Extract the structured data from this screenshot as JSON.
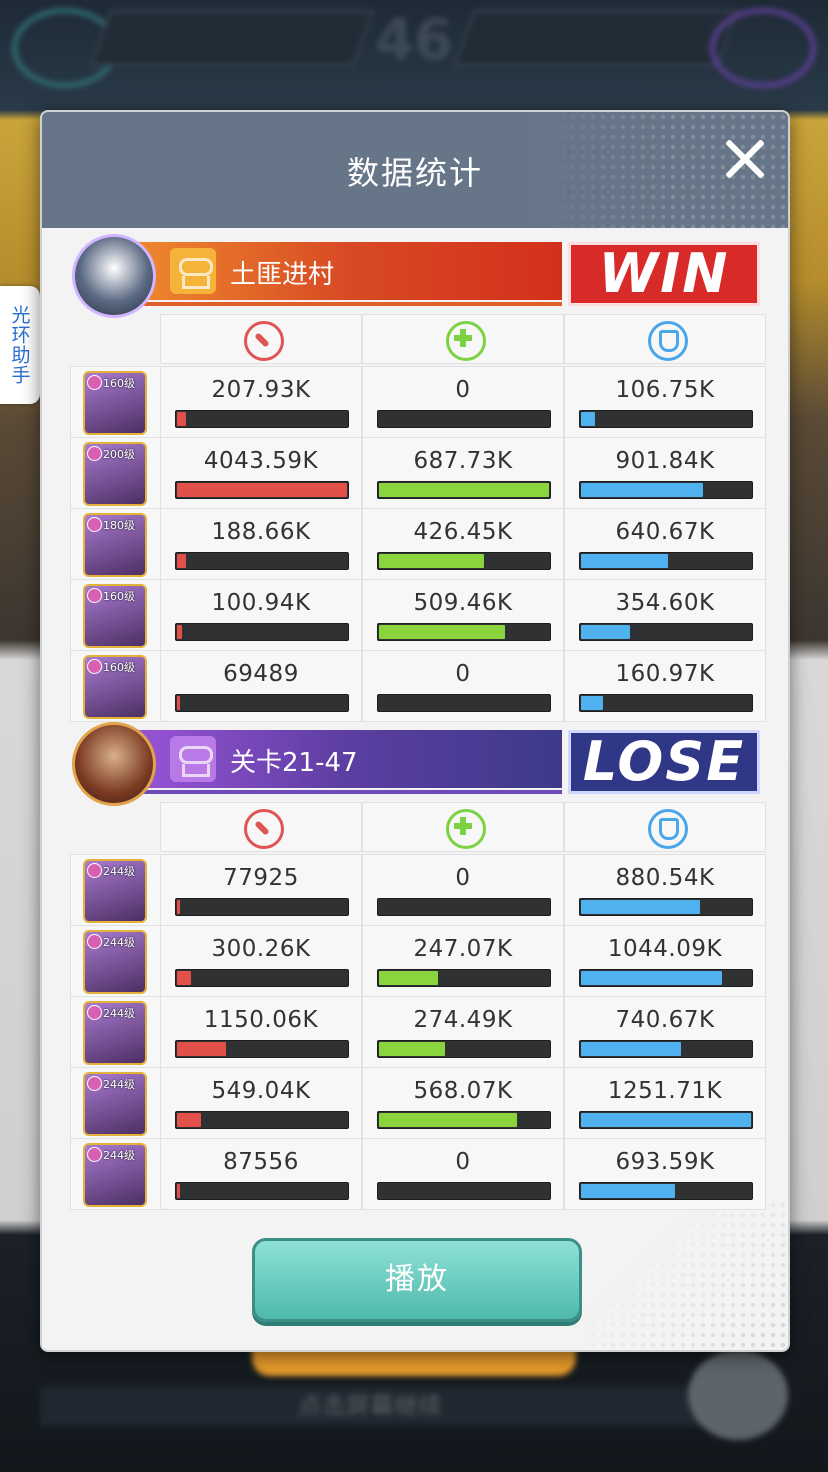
{
  "background": {
    "top_center": "46",
    "bottom_text": "点击屏幕继续"
  },
  "side_tab": {
    "label": "光环助手"
  },
  "modal": {
    "title": "数据统计",
    "play_label": "播放",
    "accent_colors": {
      "damage": "#e2504a",
      "heal": "#8ad43e",
      "defense": "#4fb1ee"
    }
  },
  "teams": [
    {
      "name": "土匪进村",
      "result": "WIN",
      "color": "#d84a23",
      "heroes": [
        {
          "level": "160级",
          "damage": "207.93K",
          "heal": "0",
          "defense": "106.75K",
          "damage_pct": 0.05,
          "heal_pct": 0,
          "defense_pct": 0.08
        },
        {
          "level": "200级",
          "damage": "4043.59K",
          "heal": "687.73K",
          "defense": "901.84K",
          "damage_pct": 1.0,
          "heal_pct": 1.0,
          "defense_pct": 0.72
        },
        {
          "level": "180级",
          "damage": "188.66K",
          "heal": "426.45K",
          "defense": "640.67K",
          "damage_pct": 0.05,
          "heal_pct": 0.62,
          "defense_pct": 0.51
        },
        {
          "level": "160级",
          "damage": "100.94K",
          "heal": "509.46K",
          "defense": "354.60K",
          "damage_pct": 0.03,
          "heal_pct": 0.74,
          "defense_pct": 0.29
        },
        {
          "level": "160级",
          "damage": "69489",
          "heal": "0",
          "defense": "160.97K",
          "damage_pct": 0.02,
          "heal_pct": 0,
          "defense_pct": 0.13
        }
      ]
    },
    {
      "name": "关卡21-47",
      "result": "LOSE",
      "color": "#3d3a8a",
      "heroes": [
        {
          "level": "244级",
          "damage": "77925",
          "heal": "0",
          "defense": "880.54K",
          "damage_pct": 0.02,
          "heal_pct": 0,
          "defense_pct": 0.7
        },
        {
          "level": "244级",
          "damage": "300.26K",
          "heal": "247.07K",
          "defense": "1044.09K",
          "damage_pct": 0.08,
          "heal_pct": 0.35,
          "defense_pct": 0.83
        },
        {
          "level": "244级",
          "damage": "1150.06K",
          "heal": "274.49K",
          "defense": "740.67K",
          "damage_pct": 0.29,
          "heal_pct": 0.39,
          "defense_pct": 0.59
        },
        {
          "level": "244级",
          "damage": "549.04K",
          "heal": "568.07K",
          "defense": "1251.71K",
          "damage_pct": 0.14,
          "heal_pct": 0.81,
          "defense_pct": 1.0
        },
        {
          "level": "244级",
          "damage": "87556",
          "heal": "0",
          "defense": "693.59K",
          "damage_pct": 0.02,
          "heal_pct": 0,
          "defense_pct": 0.55
        }
      ]
    }
  ]
}
